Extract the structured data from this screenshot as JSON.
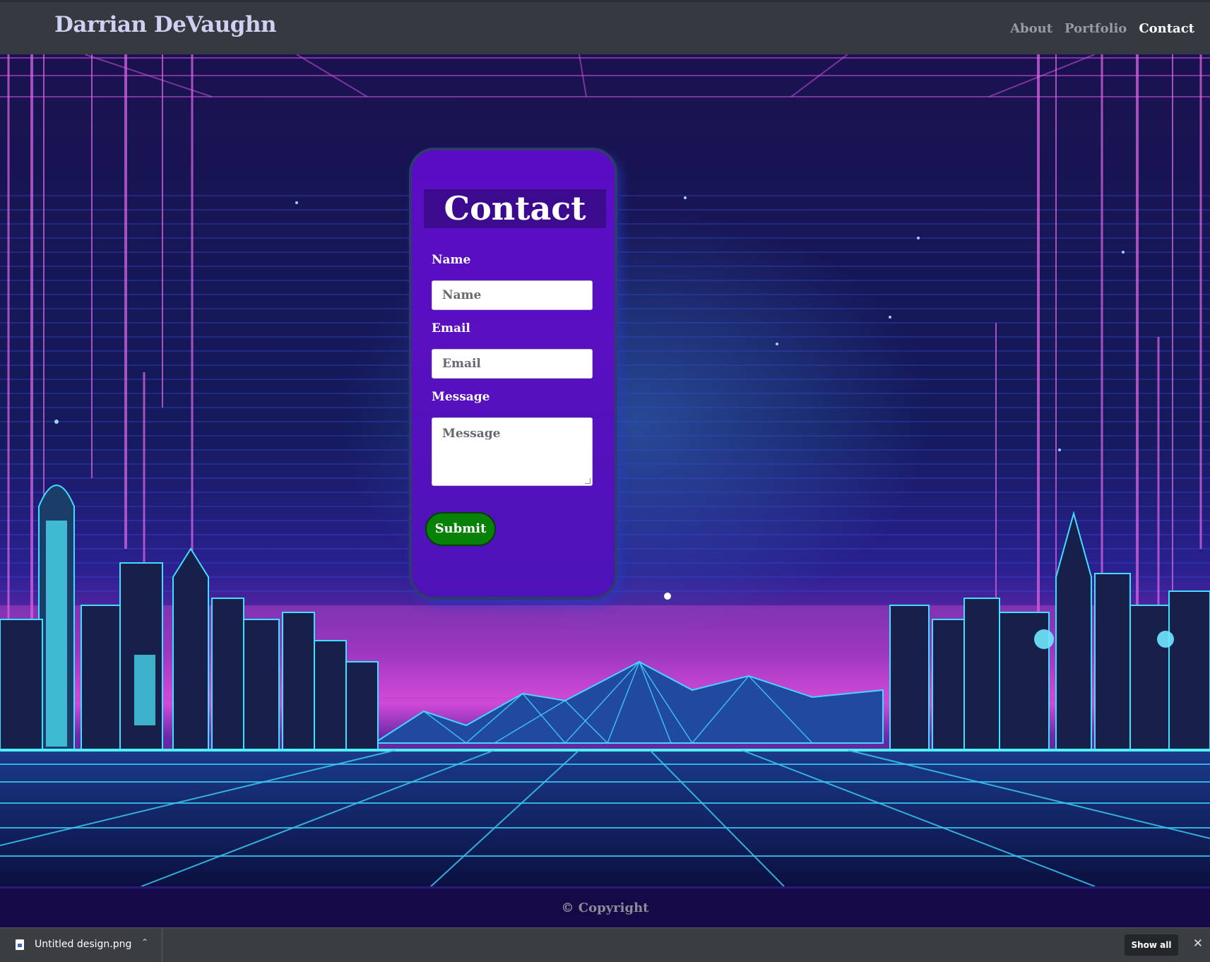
{
  "navbar": {
    "brand": "Darrian DeVaughn",
    "links": [
      {
        "label": "About",
        "active": false
      },
      {
        "label": "Portfolio",
        "active": false
      },
      {
        "label": "Contact",
        "active": true
      }
    ]
  },
  "contact_form": {
    "title": "Contact",
    "name_label": "Name",
    "name_placeholder": "Name",
    "email_label": "Email",
    "email_placeholder": "Email",
    "message_label": "Message",
    "message_placeholder": "Message",
    "submit_label": "Submit"
  },
  "footer": {
    "copyright": "© Copyright"
  },
  "download_bar": {
    "file_name": "Untitled design.png",
    "file_icon": "image-file-icon",
    "chevron_icon": "chevron-up-icon",
    "show_all_label": "Show all",
    "close_icon": "close-icon"
  },
  "colors": {
    "navbar": "#343a40",
    "card": "#5a0cc4",
    "card_title_bg": "#3c0a8f",
    "submit": "#088108",
    "footer": "#160948"
  }
}
